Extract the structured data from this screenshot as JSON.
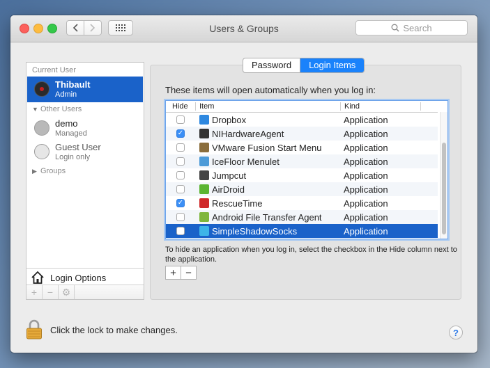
{
  "window": {
    "title": "Users & Groups"
  },
  "search": {
    "placeholder": "Search"
  },
  "sidebar": {
    "current_user_header": "Current User",
    "current_user": {
      "name": "Thibault",
      "role": "Admin"
    },
    "other_users_header": "Other Users",
    "other_users": [
      {
        "name": "demo",
        "role": "Managed"
      },
      {
        "name": "Guest User",
        "role": "Login only"
      }
    ],
    "groups_label": "Groups",
    "login_options_label": "Login Options",
    "footer": {
      "add": "+",
      "remove": "−",
      "gear": "⚙"
    }
  },
  "tabs": [
    {
      "label": "Password",
      "active": false
    },
    {
      "label": "Login Items",
      "active": true
    }
  ],
  "login_items": {
    "intro": "These items will open automatically when you log in:",
    "columns": {
      "hide": "Hide",
      "item": "Item",
      "kind": "Kind"
    },
    "rows": [
      {
        "hide": false,
        "name": "Dropbox",
        "kind": "Application",
        "icon": "dropbox-icon",
        "color": "#2e88e0"
      },
      {
        "hide": true,
        "name": "NIHardwareAgent",
        "kind": "Application",
        "icon": "ni-hardware-icon",
        "color": "#333333"
      },
      {
        "hide": false,
        "name": "VMware Fusion Start Menu",
        "kind": "Application",
        "icon": "vmware-icon",
        "color": "#8a6d3b"
      },
      {
        "hide": false,
        "name": "IceFloor Menulet",
        "kind": "Application",
        "icon": "icefloor-icon",
        "color": "#4d9bd8"
      },
      {
        "hide": false,
        "name": "Jumpcut",
        "kind": "Application",
        "icon": "jumpcut-icon",
        "color": "#444444"
      },
      {
        "hide": false,
        "name": "AirDroid",
        "kind": "Application",
        "icon": "airdroid-icon",
        "color": "#5cb532"
      },
      {
        "hide": true,
        "name": "RescueTime",
        "kind": "Application",
        "icon": "rescuetime-icon",
        "color": "#d02a2a"
      },
      {
        "hide": false,
        "name": "Android File Transfer Agent",
        "kind": "Application",
        "icon": "android-icon",
        "color": "#7fb63c"
      },
      {
        "hide": false,
        "name": "SimpleShadowSocks",
        "kind": "Application",
        "icon": "shadowsocks-icon",
        "color": "#3db4e8",
        "selected": true
      }
    ],
    "hint": "To hide an application when you log in, select the checkbox in the Hide column next to the application.",
    "add": "+",
    "remove": "−"
  },
  "footer": {
    "lock_text": "Click the lock to make changes.",
    "help": "?"
  }
}
